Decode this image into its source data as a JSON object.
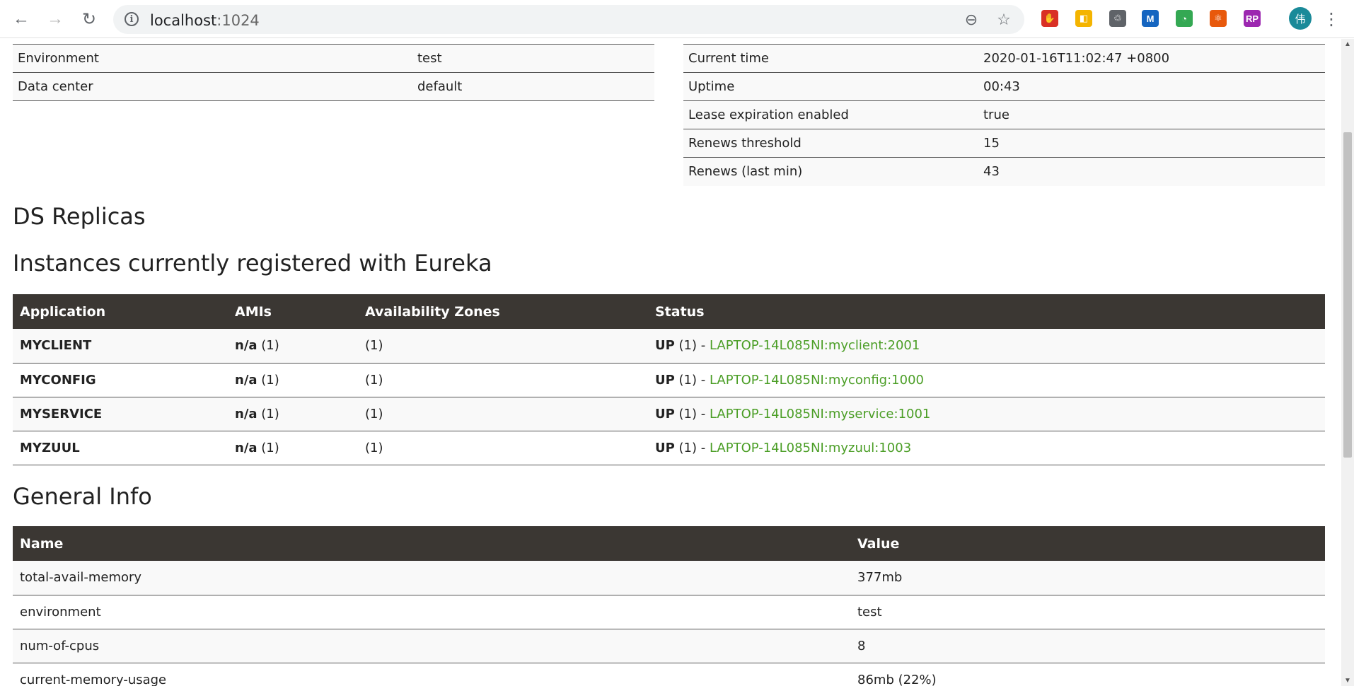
{
  "browser": {
    "url_host": "localhost",
    "url_port": ":1024",
    "avatar_text": "伟",
    "extensions": [
      {
        "name": "adblock-icon",
        "glyph": "✋",
        "color": "#d93025"
      },
      {
        "name": "image-ext-icon",
        "glyph": "◧",
        "color": "#f4b400"
      },
      {
        "name": "recycle-ext-icon",
        "glyph": "♲",
        "color": "#5f6368"
      },
      {
        "name": "m-ext-icon",
        "glyph": "M",
        "color": "#1565c0"
      },
      {
        "name": "circle-ext-icon",
        "glyph": "◔",
        "color": "#34a853"
      },
      {
        "name": "network-ext-icon",
        "glyph": "⚛",
        "color": "#e8590c"
      },
      {
        "name": "rp-ext-icon",
        "glyph": "RP",
        "color": "#9c27b0"
      }
    ]
  },
  "env_table": [
    {
      "label": "Environment",
      "value": "test"
    },
    {
      "label": "Data center",
      "value": "default"
    }
  ],
  "status_table": [
    {
      "label": "Current time",
      "value": "2020-01-16T11:02:47 +0800"
    },
    {
      "label": "Uptime",
      "value": "00:43"
    },
    {
      "label": "Lease expiration enabled",
      "value": "true"
    },
    {
      "label": "Renews threshold",
      "value": "15"
    },
    {
      "label": "Renews (last min)",
      "value": "43"
    }
  ],
  "headings": {
    "ds_replicas": "DS Replicas",
    "instances": "Instances currently registered with Eureka",
    "general_info": "General Info"
  },
  "instances": {
    "columns": [
      "Application",
      "AMIs",
      "Availability Zones",
      "Status"
    ],
    "rows": [
      {
        "app": "MYCLIENT",
        "ami": "n/a",
        "ami_count": " (1)",
        "zones": "(1)",
        "status": "UP",
        "status_count": " (1) - ",
        "instance": "LAPTOP-14L085NI:myclient:2001"
      },
      {
        "app": "MYCONFIG",
        "ami": "n/a",
        "ami_count": " (1)",
        "zones": "(1)",
        "status": "UP",
        "status_count": " (1) - ",
        "instance": "LAPTOP-14L085NI:myconfig:1000"
      },
      {
        "app": "MYSERVICE",
        "ami": "n/a",
        "ami_count": " (1)",
        "zones": "(1)",
        "status": "UP",
        "status_count": " (1) - ",
        "instance": "LAPTOP-14L085NI:myservice:1001"
      },
      {
        "app": "MYZUUL",
        "ami": "n/a",
        "ami_count": " (1)",
        "zones": "(1)",
        "status": "UP",
        "status_count": " (1) - ",
        "instance": "LAPTOP-14L085NI:myzuul:1003"
      }
    ]
  },
  "general_info": {
    "columns": [
      "Name",
      "Value"
    ],
    "rows": [
      {
        "name": "total-avail-memory",
        "value": "377mb"
      },
      {
        "name": "environment",
        "value": "test"
      },
      {
        "name": "num-of-cpus",
        "value": "8"
      },
      {
        "name": "current-memory-usage",
        "value": "86mb (22%)"
      }
    ]
  },
  "colors": {
    "table_header_bg": "#3b3733",
    "link_green": "#4b9e26"
  }
}
